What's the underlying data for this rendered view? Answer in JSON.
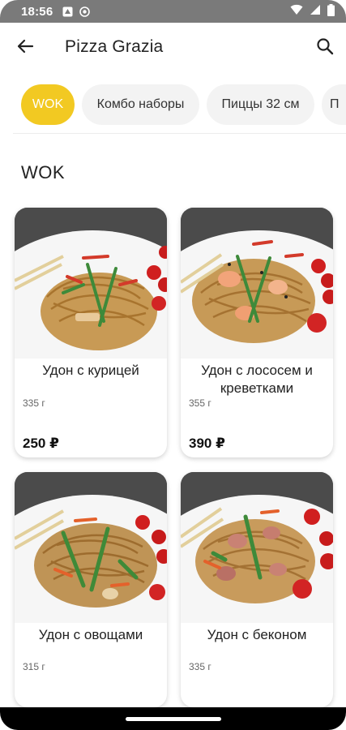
{
  "status_bar": {
    "time": "18:56"
  },
  "app_bar": {
    "title": "Pizza Grazia",
    "back_icon": "arrow-back-icon",
    "search_icon": "search-icon"
  },
  "categories": [
    {
      "label": "WOK",
      "active": true
    },
    {
      "label": "Комбо наборы",
      "active": false
    },
    {
      "label": "Пиццы 32 см",
      "active": false
    },
    {
      "label": "П",
      "active": false
    }
  ],
  "section": {
    "title": "WOK"
  },
  "products": [
    {
      "name": "Удон с курицей",
      "weight": "335 г",
      "price": "250 ₽"
    },
    {
      "name": "Удон с лососем и креветками",
      "weight": "355 г",
      "price": "390 ₽"
    },
    {
      "name": "Удон с овощами",
      "weight": "315 г"
    },
    {
      "name": "Удон с беконом",
      "weight": "335 г"
    }
  ],
  "colors": {
    "accent": "#f2c922",
    "status_bar": "#7a7a7a",
    "chip_bg": "#f3f3f3"
  }
}
